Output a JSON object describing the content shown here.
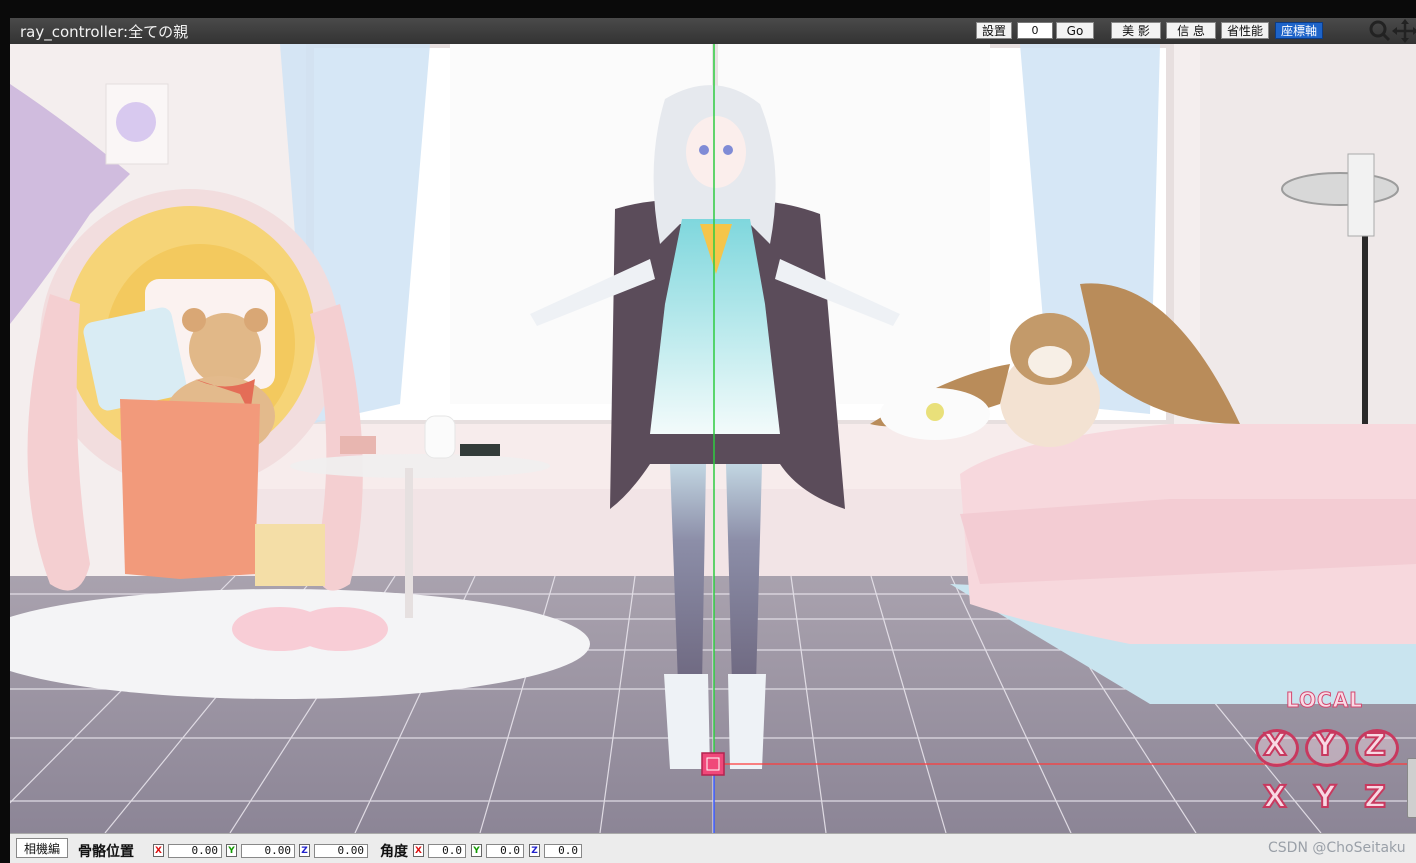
{
  "window": {
    "title": "ray_controller:全ての親",
    "toolbar": {
      "settings_label": "設置",
      "frame_value": "0",
      "go_label": "Go",
      "beauty_label": "美 影",
      "info_label": "信 息",
      "performance_label": "省性能",
      "coord_axis_label": "座標軸"
    }
  },
  "gizmo": {
    "mode_label": "LOCAL",
    "rotate": [
      "X",
      "Y",
      "Z"
    ],
    "move": [
      "X",
      "Y",
      "Z"
    ]
  },
  "bottom": {
    "camera_button": "相機編",
    "bone_position_label": "骨骼位置",
    "pos": {
      "x_tag": "X",
      "x": "0.00",
      "y_tag": "Y",
      "y": "0.00",
      "z_tag": "Z",
      "z": "0.00"
    },
    "angle_label": "角度",
    "rot": {
      "x_tag": "X",
      "x": "0.0",
      "y_tag": "Y",
      "y": "0.0",
      "z_tag": "Z",
      "z": "0.0"
    },
    "watermark": "CSDN @ChoSeitaku"
  },
  "colors": {
    "active_button": "#1d63c8",
    "gizmo_stroke": "#c8395f",
    "y_axis": "#2ecc40",
    "x_axis": "#ff3b3b",
    "z_axis": "#3a5bff"
  }
}
